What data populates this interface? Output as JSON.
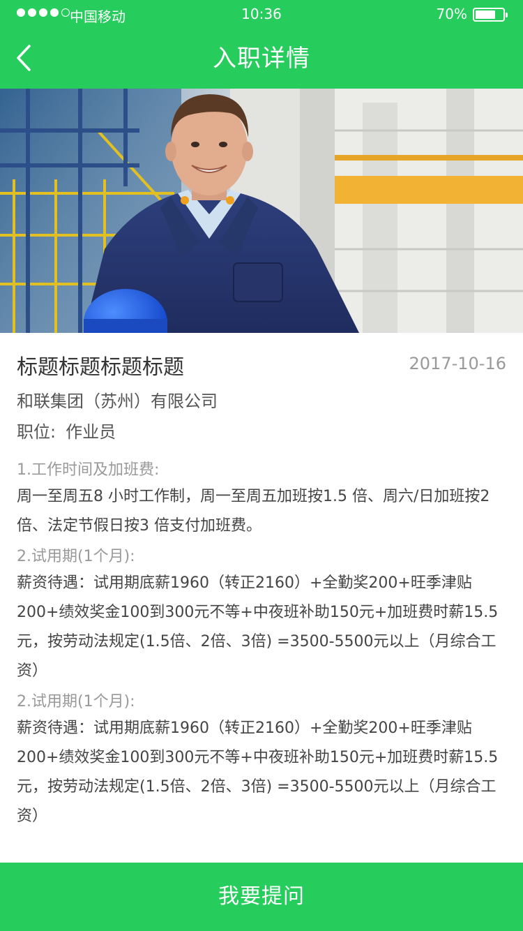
{
  "status_bar": {
    "carrier": "中国移动",
    "time": "10:36",
    "battery": "70%",
    "battery_level": 0.7
  },
  "nav": {
    "title": "入职详情",
    "back_icon": "chevron-left-icon"
  },
  "job": {
    "title": "标题标题标题标题",
    "date": "2017-10-16",
    "company": "和联集团（苏州）有限公司",
    "position_label": "职位:",
    "position_value": "作业员"
  },
  "sections": [
    {
      "heading": "1.工作时间及加班费:",
      "body": "周一至周五8 小时工作制，周一至周五加班按1.5 倍、周六/日加班按2倍、法定节假日按3 倍支付加班费。"
    },
    {
      "heading": "2.试用期(1个月):",
      "body": "薪资待遇：试用期底薪1960（转正2160）+全勤奖200+旺季津贴200+绩效奖金100到300元不等+中夜班补助150元+加班费时薪15.5元，按劳动法规定(1.5倍、2倍、3倍) =3500-5500元以上（月综合工资）"
    },
    {
      "heading": "2.试用期(1个月):",
      "body": "薪资待遇：试用期底薪1960（转正2160）+全勤奖200+旺季津贴200+绩效奖金100到300元不等+中夜班补助150元+加班费时薪15.5元，按劳动法规定(1.5倍、2倍、3倍) =3500-5500元以上（月综合工资）"
    }
  ],
  "actions": {
    "ask_label": "我要提问"
  },
  "colors": {
    "accent": "#27cd5c"
  }
}
